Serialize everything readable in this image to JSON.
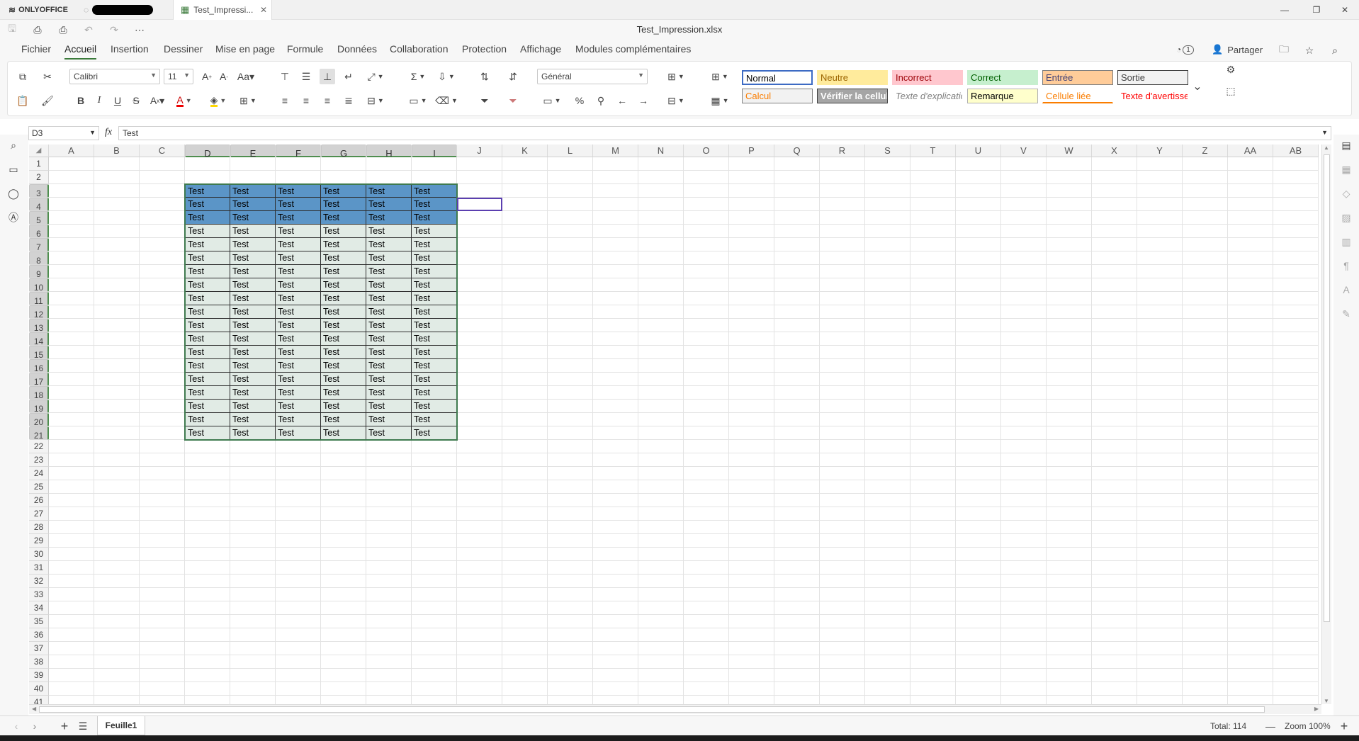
{
  "titlebar": {
    "app_name": "ONLYOFFICE",
    "doc_tab_label": "Test_Impressi...",
    "doc_title": "Test_Impression.xlsx"
  },
  "menu": {
    "items": [
      "Fichier",
      "Accueil",
      "Insertion",
      "Dessiner",
      "Mise en page",
      "Formule",
      "Données",
      "Collaboration",
      "Protection",
      "Affichage",
      "Modules complémentaires"
    ],
    "active": "Accueil",
    "users_count": "1",
    "share_label": "Partager"
  },
  "toolbar": {
    "font_name": "Calibri",
    "font_size": "11",
    "number_format": "Général",
    "styles": [
      {
        "label": "Normal",
        "bg": "#ffffff",
        "color": "#000000",
        "border": "#3d6bc4"
      },
      {
        "label": "Neutre",
        "bg": "#ffeb9c",
        "color": "#9c6500",
        "border": "#ffeb9c"
      },
      {
        "label": "Incorrect",
        "bg": "#ffc7ce",
        "color": "#9c0006",
        "border": "#ffc7ce"
      },
      {
        "label": "Correct",
        "bg": "#c6efce",
        "color": "#006100",
        "border": "#c6efce"
      },
      {
        "label": "Entrée",
        "bg": "#ffcc99",
        "color": "#3f3f76",
        "border": "#7f7f7f"
      },
      {
        "label": "Sortie",
        "bg": "#f2f2f2",
        "color": "#3f3f3f",
        "border": "#3f3f3f"
      },
      {
        "label": "Calcul",
        "bg": "#f2f2f2",
        "color": "#fa7d00",
        "border": "#7f7f7f"
      },
      {
        "label": "Vérifier la cellule",
        "bg": "#a5a5a5",
        "color": "#ffffff",
        "border": "#3f3f3f"
      },
      {
        "label": "Texte d'explication",
        "bg": "#ffffff",
        "color": "#7f7f7f",
        "border": "#ffffff"
      },
      {
        "label": "Remarque",
        "bg": "#ffffcc",
        "color": "#000000",
        "border": "#b2b2b2"
      },
      {
        "label": "Cellule liée",
        "bg": "#ffffff",
        "color": "#fa7d00",
        "border": "#ffffff"
      },
      {
        "label": "Texte d'avertissement",
        "bg": "#ffffff",
        "color": "#ff0000",
        "border": "#ffffff"
      }
    ]
  },
  "formula_bar": {
    "cell_ref": "D3",
    "fx": "fx",
    "value": "Test"
  },
  "sheet": {
    "columns": [
      "A",
      "B",
      "C",
      "D",
      "E",
      "F",
      "G",
      "H",
      "I",
      "J",
      "K",
      "L",
      "M",
      "N",
      "O",
      "P",
      "Q",
      "R",
      "S",
      "T",
      "U",
      "V",
      "W",
      "X",
      "Y",
      "Z",
      "AA",
      "AB"
    ],
    "rows": [
      "1",
      "2",
      "3",
      "4",
      "5",
      "6",
      "7",
      "8",
      "9",
      "10",
      "11",
      "12",
      "13",
      "14",
      "15",
      "16",
      "17",
      "18",
      "19",
      "20",
      "21",
      "22",
      "23",
      "24",
      "25",
      "26",
      "27",
      "28",
      "29",
      "30",
      "31",
      "32",
      "33",
      "34",
      "35",
      "36",
      "37",
      "38",
      "39",
      "40",
      "41"
    ],
    "cell_text": "Test",
    "header_fill": "#5b95c7",
    "body_fill": "#e1ebe5"
  },
  "status": {
    "sheet_tab": "Feuille1",
    "total": "Total: 114",
    "zoom": "Zoom 100%"
  }
}
